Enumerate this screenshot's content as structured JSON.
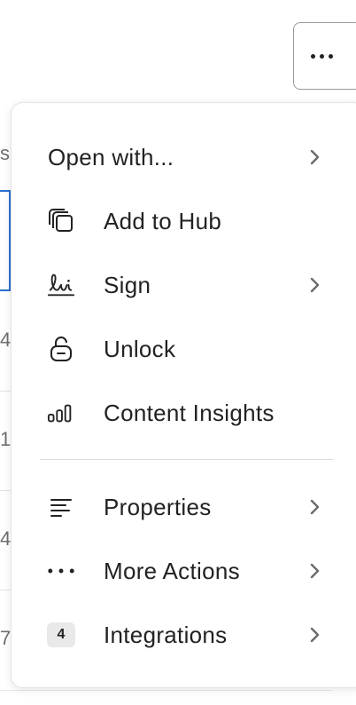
{
  "header": {
    "more_button_icon": "ellipsis-icon"
  },
  "background": {
    "left_fragments": [
      "s",
      "4",
      "1",
      "4",
      "7"
    ]
  },
  "menu": {
    "items": [
      {
        "label": "Open with...",
        "icon": "none",
        "has_submenu": true
      },
      {
        "label": "Add to Hub",
        "icon": "hub-stack-icon",
        "has_submenu": false
      },
      {
        "label": "Sign",
        "icon": "signature-icon",
        "has_submenu": true
      },
      {
        "label": "Unlock",
        "icon": "unlock-icon",
        "has_submenu": false
      },
      {
        "label": "Content Insights",
        "icon": "bar-chart-icon",
        "has_submenu": false
      },
      {
        "label": "Properties",
        "icon": "properties-lines-icon",
        "has_submenu": true
      },
      {
        "label": "More Actions",
        "icon": "ellipsis-icon",
        "has_submenu": true
      },
      {
        "label": "Integrations",
        "icon": "count-badge",
        "badge": "4",
        "has_submenu": true
      }
    ]
  },
  "colors": {
    "accent_blue": "#2c6fd1",
    "text": "#222222",
    "chevron": "#6b6b6b",
    "badge_bg": "#e9e9e9"
  }
}
